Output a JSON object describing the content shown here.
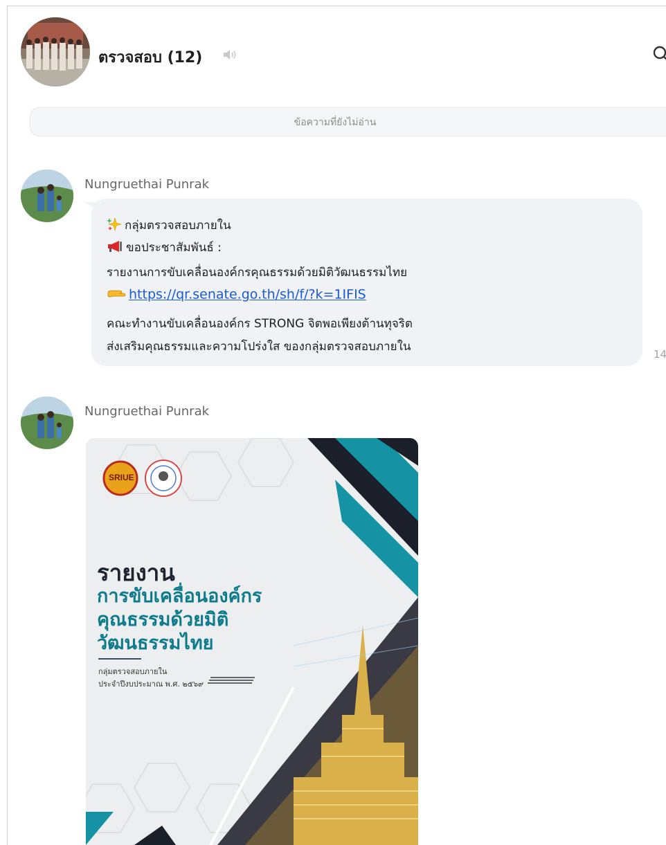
{
  "header": {
    "group_name": "ตรวจสอบ (12)",
    "icons": {
      "mute": "speaker-muted-icon",
      "search": "search-icon"
    }
  },
  "divider": {
    "unread_label": "ข้อความที่ยังไม่อ่าน"
  },
  "messages": [
    {
      "sender": "Nungruethai Punrak",
      "lines": [
        "กลุ่มตรวจสอบภายใน",
        "ขอประชาสัมพันธ์ :",
        "รายงานการขับเคลื่อนองค์กรคุณธรรมด้วยมิติวัฒนธรรมไทย",
        "https://qr.senate.go.th/sh/f/?k=1IFIS",
        "คณะทำงานขับเคลื่อนองค์กร STRONG จิตพอเพียงต้านทุจริต",
        "ส่งเสริมคุณธรรมและความโปร่งใส ของกลุ่มตรวจสอบภายใน"
      ],
      "timestamp": "14"
    },
    {
      "sender": "Nungruethai Punrak",
      "poster": {
        "logo_text": "SRIUE",
        "title": "รายงาน",
        "subtitle_lines": [
          "การขับเคลื่อนองค์กร",
          "คุณธรรมด้วยมิติ",
          "วัฒนธรรมไทย"
        ],
        "small_lines": [
          "กลุ่มตรวจสอบภายใน",
          "ประจำปีงบประมาณ พ.ศ. ๒๕๖๙"
        ]
      }
    }
  ],
  "colors": {
    "link": "#1a5ad7",
    "teal": "#0e7b8c",
    "bubble": "#f0f2f5"
  }
}
